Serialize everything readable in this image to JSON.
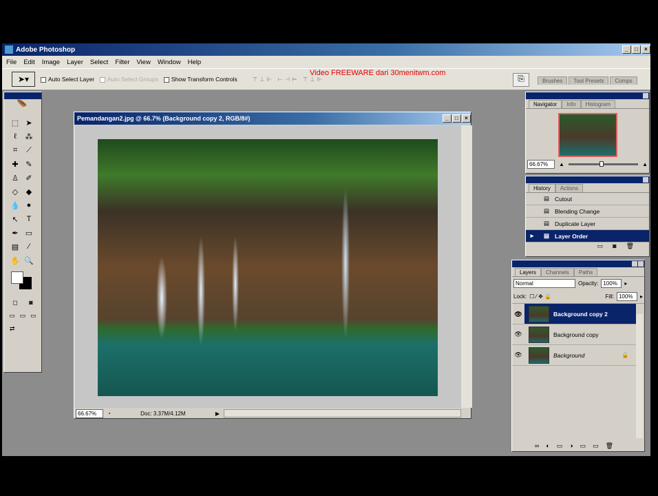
{
  "app": {
    "title": "Adobe Photoshop",
    "watermark": "Video FREEWARE dari 30menitwm.com"
  },
  "menu": [
    "File",
    "Edit",
    "Image",
    "Layer",
    "Select",
    "Filter",
    "View",
    "Window",
    "Help"
  ],
  "options": {
    "auto_select_layer": "Auto Select Layer",
    "auto_select_groups": "Auto Select Groups",
    "show_transform": "Show Transform Controls"
  },
  "palette_well": [
    "Brushes",
    "Tool Presets",
    "Comps"
  ],
  "document": {
    "title": "Pemandangan2.jpg @ 66.7% (Background copy 2, RGB/8#)",
    "zoom": "66.67%",
    "doc_size": "Doc: 3.37M/4.12M"
  },
  "navigator": {
    "tabs": [
      "Navigator",
      "Info",
      "Histogram"
    ],
    "zoom": "66.67%"
  },
  "history": {
    "tabs": [
      "History",
      "Actions"
    ],
    "items": [
      "Cutout",
      "Blending Change",
      "Duplicate Layer",
      "Layer Order"
    ],
    "selected": 3
  },
  "layers": {
    "tabs": [
      "Layers",
      "Channels",
      "Paths"
    ],
    "blend_mode": "Normal",
    "opacity_label": "Opacity:",
    "opacity": "100%",
    "lock_label": "Lock:",
    "fill_label": "Fill:",
    "fill": "100%",
    "items": [
      "Background copy 2",
      "Background copy",
      "Background"
    ],
    "selected": 0
  },
  "colors": {
    "accent": "#0a246a",
    "workspace": "#8c8c8c",
    "watermark": "#e00000"
  }
}
